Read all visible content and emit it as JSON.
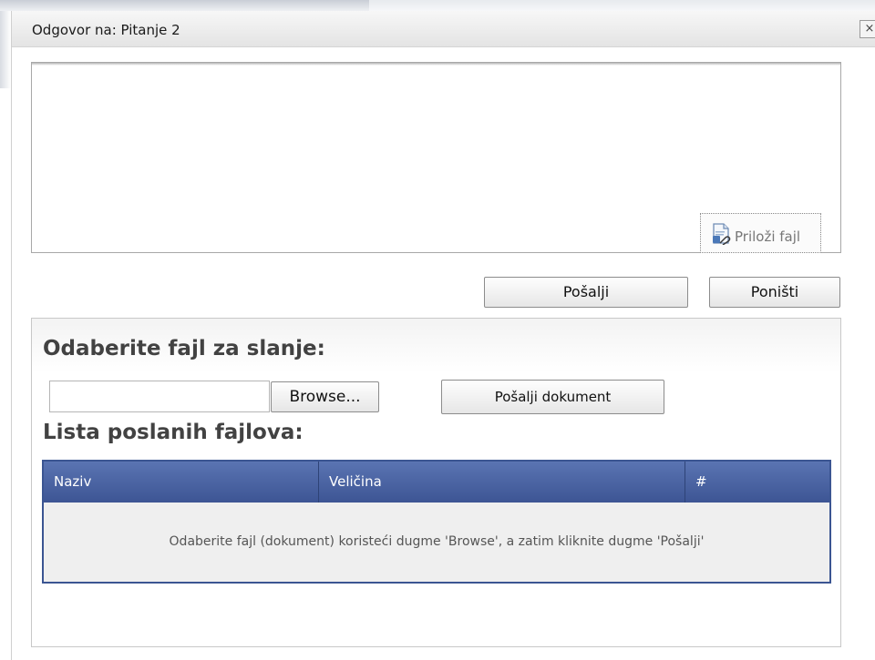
{
  "dialog": {
    "title": "Odgovor na: Pitanje 2",
    "close_glyph": "×"
  },
  "editor": {
    "attach_label": "Priloži fajl",
    "attach_icon": "document-attach-icon"
  },
  "actions": {
    "send_label": "Pošalji",
    "cancel_label": "Poništi"
  },
  "upload": {
    "title": "Odaberite fajl za slanje:",
    "file_value": "",
    "browse_label": "Browse...",
    "send_document_label": "Pošalji dokument"
  },
  "files_list": {
    "title": "Lista poslanih fajlova:",
    "columns": [
      "Naziv",
      "Veličina",
      "#"
    ],
    "empty_message": "Odaberite fajl (dokument) koristeći dugme 'Browse', a zatim kliknite dugme 'Pošalji'"
  },
  "colors": {
    "table_header": "#3d5594",
    "table_border": "#3b5592",
    "table_body": "#efefef",
    "heading_text": "#424242"
  }
}
